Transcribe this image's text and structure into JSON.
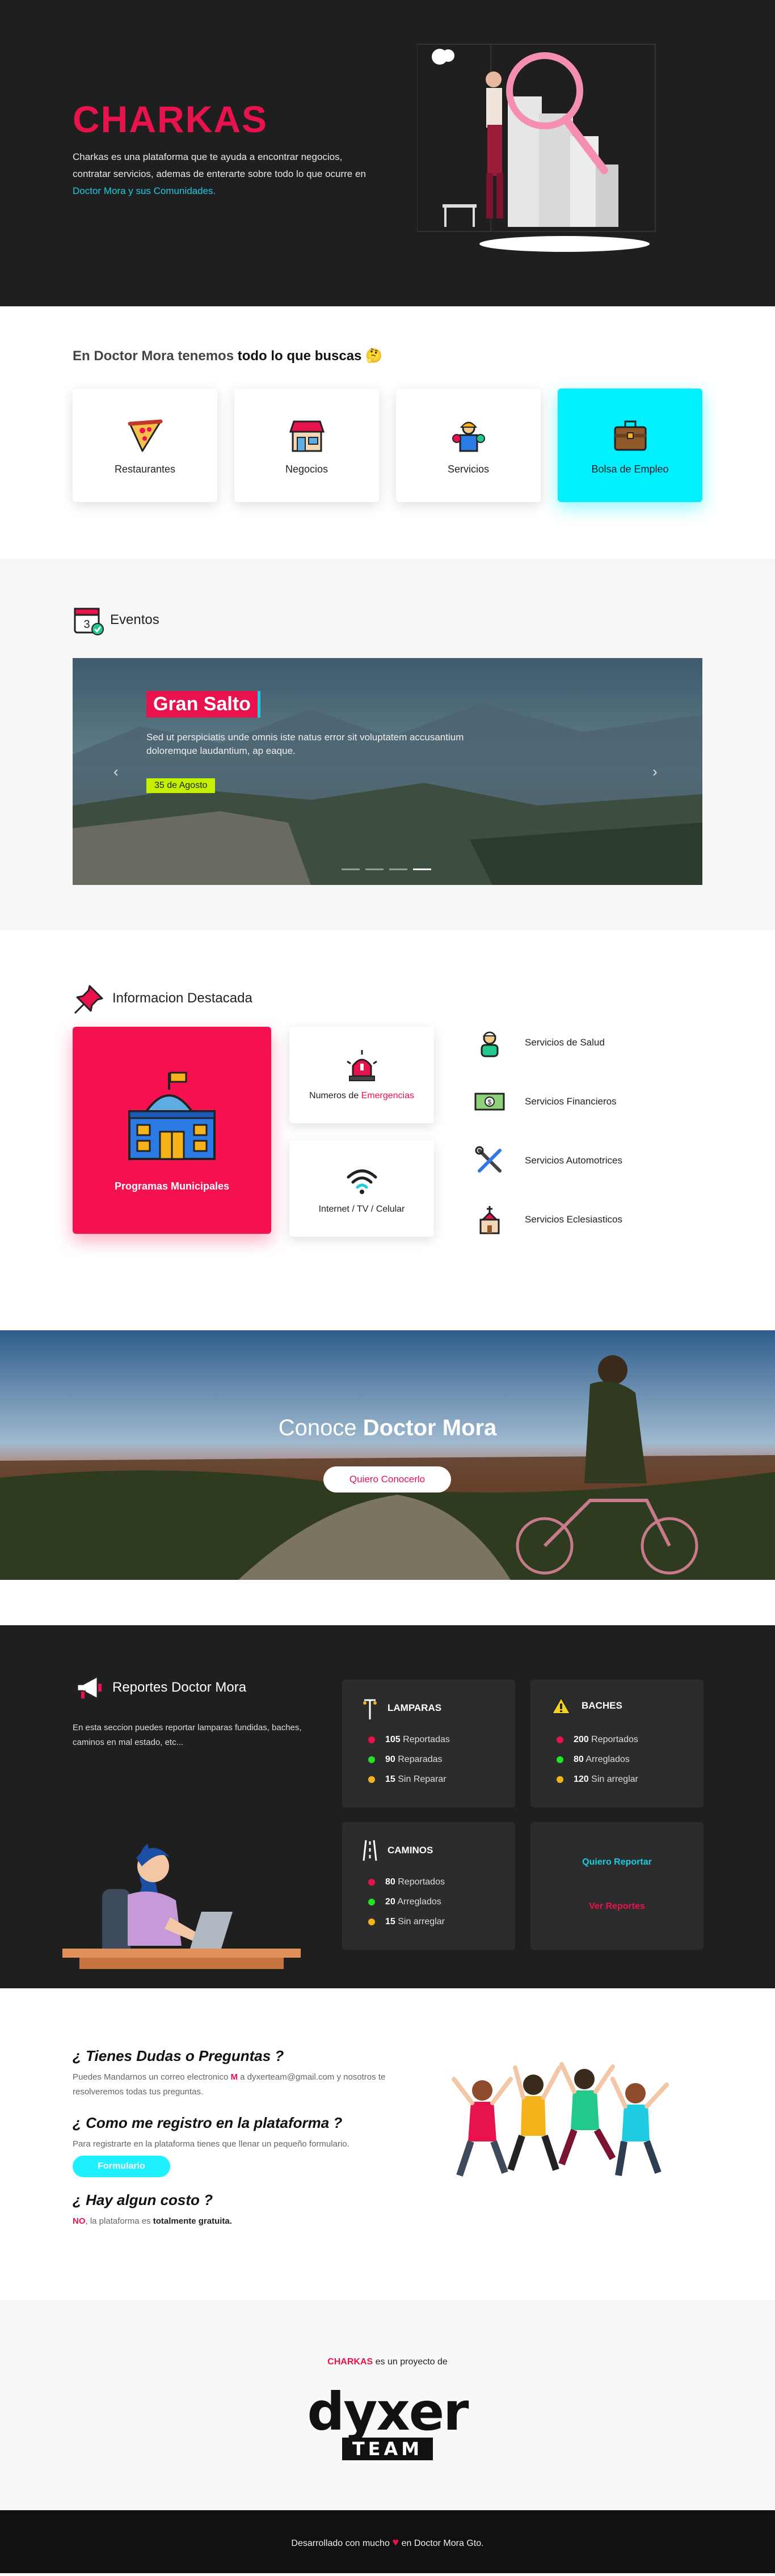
{
  "hero": {
    "title": "CHARKAS",
    "desc_text": "Charkas es una plataforma que te ayuda a encontrar negocios, contratar servicios, ademas de enterarte sobre todo lo que ocurre en ",
    "desc_link": "Doctor Mora y sus Comunidades."
  },
  "categories": {
    "head_plain": "En Doctor Mora tenemos ",
    "head_bold": "todo lo que buscas",
    "items": [
      {
        "label": "Restaurantes",
        "icon": "pizza-icon"
      },
      {
        "label": "Negocios",
        "icon": "store-icon"
      },
      {
        "label": "Servicios",
        "icon": "workers-icon"
      },
      {
        "label": "Bolsa de Empleo",
        "icon": "briefcase-icon"
      }
    ],
    "highlight_color": "#00f0ff"
  },
  "events": {
    "head": "Eventos",
    "slide": {
      "title": "Gran Salto",
      "desc": "Sed ut perspiciatis unde omnis iste natus error sit voluptatem accusantium doloremque laudantium, ap eaque.",
      "date": "35 de Agosto"
    }
  },
  "info": {
    "head": "Informacion Destacada",
    "program": "Programas Municipales",
    "emergency_prefix": "Numeros de ",
    "emergency_em": "Emergencias",
    "internet": "Internet / TV / Celular",
    "services": [
      {
        "label": "Servicios de Salud",
        "icon": "nurse-icon"
      },
      {
        "label": "Servicios Financieros",
        "icon": "money-icon"
      },
      {
        "label": "Servicios Automotrices",
        "icon": "tools-icon"
      },
      {
        "label": "Servicios Eclesiasticos",
        "icon": "church-icon"
      }
    ]
  },
  "banner": {
    "title_plain": "Conoce ",
    "title_bold": "Doctor Mora",
    "button": "Quiero Conocerlo"
  },
  "reports": {
    "head": "Reportes Doctor Mora",
    "desc": "En esta seccion puedes reportar lamparas fundidas, baches, caminos en mal estado, etc...",
    "lamparas": {
      "title": "LAMPARAS",
      "rows": [
        [
          "105",
          "Reportadas"
        ],
        [
          "90",
          "Reparadas"
        ],
        [
          "15",
          "Sin Reparar"
        ]
      ]
    },
    "baches": {
      "title": "BACHES",
      "rows": [
        [
          "200",
          "Reportados"
        ],
        [
          "80",
          "Arreglados"
        ],
        [
          "120",
          "Sin arreglar"
        ]
      ]
    },
    "caminos": {
      "title": "CAMINOS",
      "rows": [
        [
          "80",
          "Reportados"
        ],
        [
          "20",
          "Arreglados"
        ],
        [
          "15",
          "Sin arreglar"
        ]
      ]
    },
    "quiero": "Quiero Reportar",
    "ver": "Ver Reportes",
    "status_colors": [
      "#e8134c",
      "#23e322",
      "#f5b21b"
    ]
  },
  "faq": {
    "q1": "¿ Tienes Dudas o Preguntas ?",
    "a1_part1": "Puedes Mandarnos un correo electronico ",
    "a1_part2": " a dyxerteam@gmail.com y nosotros te resolveremos todas tus preguntas.",
    "q2": "¿ Como me registro en la plataforma ?",
    "a2": "Para registrarte en la plataforma tienes que llenar un pequeño formulario.",
    "form_button": "Formulario",
    "q3": "¿ Hay algun costo ?",
    "a3_no": "NO",
    "a3_mid": ", la plataforma es ",
    "a3_bold": "totalmente gratuita."
  },
  "dyxer": {
    "brand": "CHARKAS",
    "rest": " es un proyecto de",
    "logo_word": "dyxer",
    "logo_team": "TEAM"
  },
  "footer": {
    "pre": "Desarrollado con mucho ",
    "post": " en Doctor Mora Gto."
  }
}
